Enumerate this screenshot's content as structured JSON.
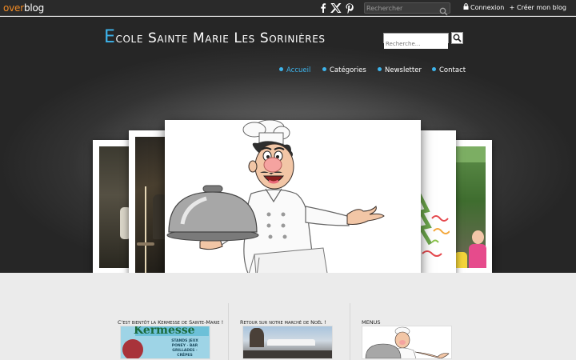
{
  "topbar": {
    "logo_part1": "over",
    "logo_part2": "blog",
    "social_icons": [
      "facebook-icon",
      "x-twitter-icon",
      "pinterest-icon"
    ],
    "search_placeholder": "Rechercher",
    "login_label": "Connexion",
    "create_blog_label": "Créer mon blog",
    "create_blog_icon": "+"
  },
  "header": {
    "title_first_letter": "E",
    "title_rest": "cole Sainte Marie Les Sorinières",
    "search_placeholder": "Recherche...",
    "nav": [
      {
        "label": "Accueil",
        "active": true
      },
      {
        "label": "Catégories",
        "active": false
      },
      {
        "label": "Newsletter",
        "active": false
      },
      {
        "label": "Contact",
        "active": false
      }
    ]
  },
  "carousel": {
    "accent_color": "#3db4ec",
    "slides": [
      "photo-slide",
      "stage-photo-slide",
      "chef-illustration-slide",
      "christmas-craft-slide",
      "children-photo-slide"
    ]
  },
  "posts": [
    {
      "title": "C'est bientôt la Kermesse de Sainte-Marie !",
      "image_text": "Kermesse",
      "image_caption": "STANDS JEUX PONEY · BAR GRILLADES · CRÊPES"
    },
    {
      "title": "Retour sur notre marché de Noël !"
    },
    {
      "title": "MENUS"
    }
  ]
}
